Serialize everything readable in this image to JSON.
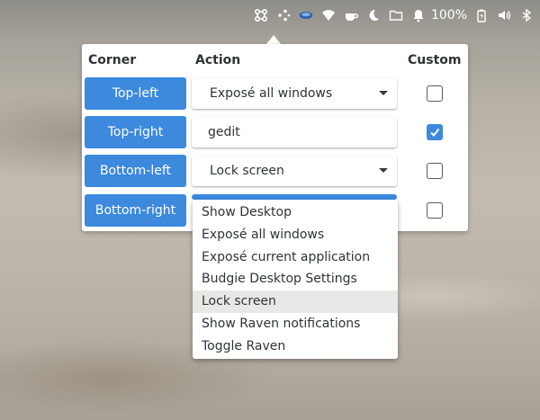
{
  "tray": {
    "battery_text": "100%",
    "icons": [
      "budgie-menu-icon",
      "raven-dots-icon",
      "network-app-icon",
      "wifi-icon",
      "caffeine-cup-icon",
      "night-light-moon-icon",
      "folder-icon",
      "notification-bell-icon",
      "battery-icon",
      "volume-icon",
      "bluetooth-icon"
    ]
  },
  "panel": {
    "headers": {
      "corner": "Corner",
      "action": "Action",
      "custom": "Custom"
    },
    "rows": [
      {
        "corner": "Top-left",
        "action": "Exposé all windows",
        "type": "select",
        "custom": false
      },
      {
        "corner": "Top-right",
        "action": "gedit",
        "type": "entry",
        "custom": true
      },
      {
        "corner": "Bottom-left",
        "action": "Lock screen",
        "type": "select",
        "custom": false
      },
      {
        "corner": "Bottom-right",
        "action": "",
        "type": "select-open",
        "custom": false
      }
    ]
  },
  "dropdown": {
    "items": [
      "Show Desktop",
      "Exposé all windows",
      "Exposé current application",
      "Budgie Desktop Settings",
      "Lock screen",
      "Show Raven notifications",
      "Toggle Raven"
    ],
    "highlighted": "Lock screen"
  },
  "colors": {
    "accent": "#3c89de",
    "panel_bg": "#ffffff",
    "text": "#2e3436"
  }
}
